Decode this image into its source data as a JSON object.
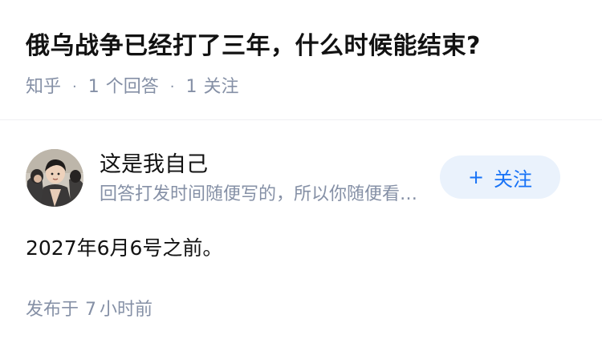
{
  "question": {
    "title": "俄乌战争已经打了三年，什么时候能结束?",
    "meta": {
      "source": "知乎",
      "separator": "·",
      "answer_count": "1",
      "answer_label": "个回答",
      "follow_count": "1",
      "follow_label": "关注"
    }
  },
  "answer": {
    "author": {
      "name": "这是我自己",
      "bio": "回答打发时间随便写的，所以你随便看看就好",
      "avatar_icon": "user-avatar"
    },
    "follow_button": {
      "icon": "+",
      "label": "关注"
    },
    "content": "2027年6月6号之前。",
    "published": {
      "prefix": "发布于",
      "value": "7",
      "unit": "小时前"
    }
  },
  "colors": {
    "title": "#121212",
    "meta": "#8590a6",
    "accent": "#1772f6",
    "follow_bg": "#eaf2fc",
    "divider": "#f0f0f2"
  }
}
